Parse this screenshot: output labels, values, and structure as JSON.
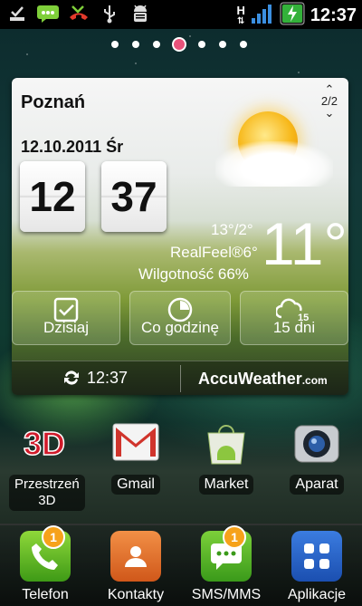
{
  "status_bar": {
    "time": "12:37",
    "left_icons": [
      "download-done-icon",
      "sms-icon",
      "missed-call-icon",
      "usb-icon",
      "android-debug-icon"
    ],
    "right_icons": [
      "hspa-icon",
      "signal-icon",
      "battery-charging-icon"
    ],
    "network_label": "H"
  },
  "home": {
    "page_count": 7,
    "active_page": 4
  },
  "weather_widget": {
    "city": "Poznań",
    "page_indicator": "2/2",
    "date": "12.10.2011 Śr",
    "clock_hours": "12",
    "clock_minutes": "37",
    "min_max": "13°/2°",
    "realfeel": "RealFeel®6°",
    "humidity": "Wilgotność 66%",
    "temperature": "11°",
    "buttons": [
      {
        "label": "Dzisiaj",
        "icon": "calendar-check-icon"
      },
      {
        "label": "Co godzinę",
        "icon": "clock-icon"
      },
      {
        "label": "15 dni",
        "icon": "cloud-15-icon",
        "icon_text": "15"
      }
    ],
    "last_update": "12:37",
    "brand_main": "AccuWeather",
    "brand_suffix": ".com",
    "accent_color": "#f7b81a"
  },
  "apps": [
    {
      "label": "Przestrzeń 3D",
      "line1": "Przestrzeń",
      "line2": "3D",
      "icon": "3d-space-icon"
    },
    {
      "label": "Gmail",
      "icon": "gmail-icon"
    },
    {
      "label": "Market",
      "icon": "market-icon"
    },
    {
      "label": "Aparat",
      "icon": "camera-icon"
    }
  ],
  "dock": [
    {
      "label": "Telefon",
      "icon": "phone-icon",
      "badge": "1"
    },
    {
      "label": "Kontakty",
      "icon": "contacts-icon"
    },
    {
      "label": "SMS/MMS",
      "icon": "messaging-icon",
      "badge": "1"
    },
    {
      "label": "Aplikacje",
      "icon": "apps-grid-icon"
    }
  ]
}
